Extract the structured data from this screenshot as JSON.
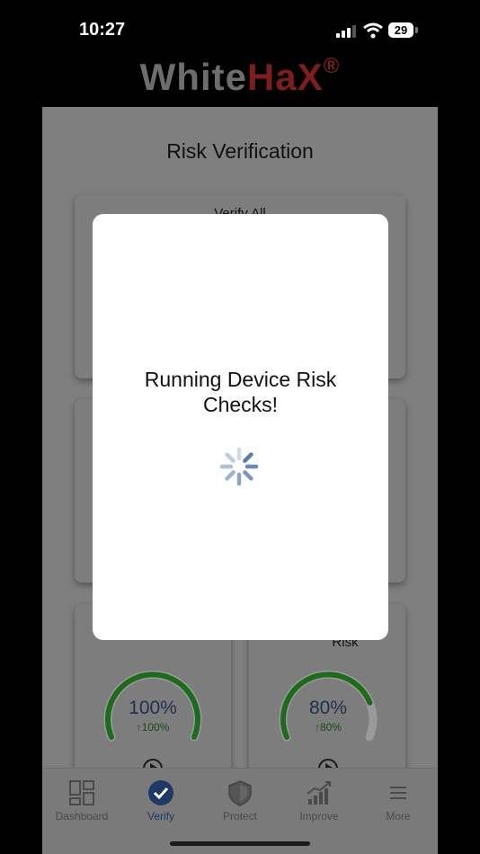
{
  "status_bar": {
    "time": "10:27",
    "battery": "29"
  },
  "brand": {
    "part1": "White",
    "part2": "HaX",
    "mark": "®"
  },
  "page": {
    "title": "Risk Verification"
  },
  "cards": {
    "verify_all_label": "Verify All",
    "right_card_label": "Risk",
    "left_gauge": {
      "value": "100%",
      "delta": "↑100%",
      "progress": 1.0
    },
    "right_gauge": {
      "value": "80%",
      "delta": "↑80%",
      "progress": 0.8
    }
  },
  "modal": {
    "message": "Running Device Risk Checks!"
  },
  "tabs": [
    {
      "label": "Dashboard",
      "icon": "dashboard-icon"
    },
    {
      "label": "Verify",
      "icon": "checkmark-circle-icon",
      "active": true
    },
    {
      "label": "Protect",
      "icon": "shield-icon"
    },
    {
      "label": "Improve",
      "icon": "chart-trend-icon"
    },
    {
      "label": "More",
      "icon": "menu-icon"
    }
  ],
  "colors": {
    "brand_gray": "#6d6d6d",
    "brand_red": "#7c1e1e",
    "active_tab": "#1d3a66",
    "gauge_green": "#1e6b1e"
  }
}
